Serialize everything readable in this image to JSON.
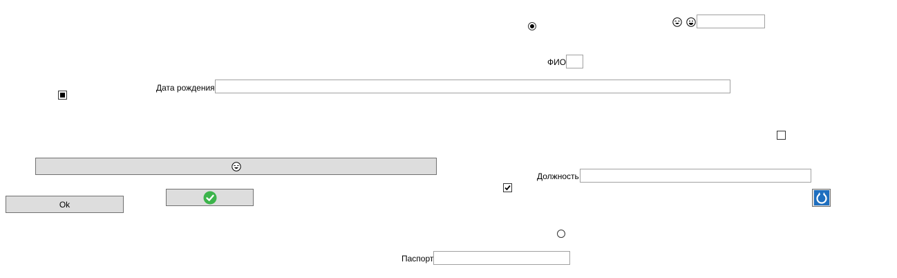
{
  "form": {
    "fio_label": "ФИО",
    "fio_value": "",
    "birthdate_label": "Дата рождения",
    "birthdate_value": "",
    "position_label": "Должность",
    "position_value": "",
    "passport_label": "Паспорт",
    "passport_value": "",
    "top_right_value": ""
  },
  "buttons": {
    "ok_label": "Ok",
    "emoji_button_icon": "laughing-face-icon",
    "confirm_button_icon": "green-checkmark-icon",
    "image_button_icon": "blue-refresh-icon"
  },
  "controls": {
    "radio_top_checked": true,
    "radio_bottom_checked": false,
    "checkbox_left_state": "indeterminate",
    "checkbox_right_checked": false,
    "checkbox_middle_checked": true
  },
  "icons": {
    "top_emoji_1": "laughing-face-icon",
    "top_emoji_2": "grinning-face-icon"
  },
  "colors": {
    "button_face": "#dddddd",
    "border": "#a0a0a0",
    "check_green": "#3cb44b",
    "refresh_blue": "#1f6fbf"
  }
}
